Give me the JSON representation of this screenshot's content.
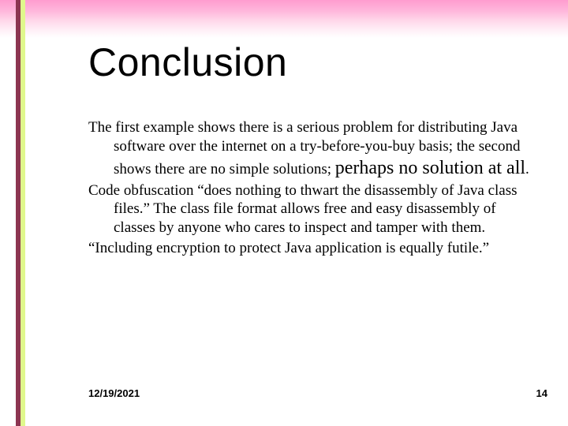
{
  "title": "Conclusion",
  "paragraphs": {
    "p1a": "The first example shows there is a serious problem for distributing Java software over the internet on a try-before-you-buy basis; the second shows there are no simple solutions; ",
    "p1b": "perhaps no solution at all",
    "p1c": ".",
    "p2": "Code obfuscation “does nothing to thwart the disassembly of Java class files.” The class file format allows free and easy disassembly of classes by anyone who cares to inspect and tamper with them.",
    "p3": "“Including encryption to protect Java application is equally futile.”"
  },
  "footer": {
    "date": "12/19/2021",
    "page": "14"
  }
}
